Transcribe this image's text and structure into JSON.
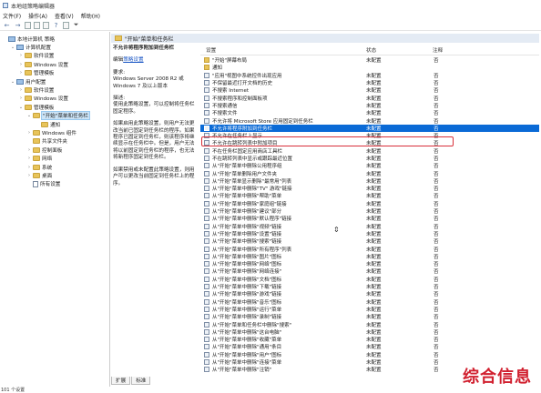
{
  "window": {
    "title": "本地组策略编辑器"
  },
  "menu": [
    "文件(F)",
    "操作(A)",
    "查看(V)",
    "帮助(H)"
  ],
  "toolbar_icons": [
    "back-arrow-icon",
    "forward-arrow-icon",
    "up-folder-icon",
    "show-tree-icon",
    "properties-icon",
    "help-icon",
    "filter-icon"
  ],
  "tree": [
    {
      "label": "本地计算机 策略",
      "level": 0,
      "type": "pc",
      "toggle": ""
    },
    {
      "label": "计算机配置",
      "level": 1,
      "type": "pc",
      "toggle": "v"
    },
    {
      "label": "软件设置",
      "level": 2,
      "type": "folder",
      "toggle": ">"
    },
    {
      "label": "Windows 设置",
      "level": 2,
      "type": "folder",
      "toggle": ">"
    },
    {
      "label": "管理模板",
      "level": 2,
      "type": "folder",
      "toggle": ">"
    },
    {
      "label": "用户配置",
      "level": 1,
      "type": "pc",
      "toggle": "v"
    },
    {
      "label": "软件设置",
      "level": 2,
      "type": "folder",
      "toggle": ">"
    },
    {
      "label": "Windows 设置",
      "level": 2,
      "type": "folder",
      "toggle": ">"
    },
    {
      "label": "管理模板",
      "level": 2,
      "type": "folder",
      "toggle": "v"
    },
    {
      "label": "\"开始\"菜单和任务栏",
      "level": 3,
      "type": "folder",
      "toggle": "v",
      "selected": true
    },
    {
      "label": "通知",
      "level": 4,
      "type": "folder",
      "toggle": ""
    },
    {
      "label": "Windows 组件",
      "level": 3,
      "type": "folder",
      "toggle": ">"
    },
    {
      "label": "共享文件夹",
      "level": 3,
      "type": "folder",
      "toggle": ""
    },
    {
      "label": "控制面板",
      "level": 3,
      "type": "folder",
      "toggle": ">"
    },
    {
      "label": "网络",
      "level": 3,
      "type": "folder",
      "toggle": ">"
    },
    {
      "label": "系统",
      "level": 3,
      "type": "folder",
      "toggle": ">"
    },
    {
      "label": "桌面",
      "level": 3,
      "type": "folder",
      "toggle": ">"
    },
    {
      "label": "所有设置",
      "level": 3,
      "type": "doc",
      "toggle": ""
    }
  ],
  "right_header": "\"开始\"菜单和任务栏",
  "description": {
    "title": "不允许将程序附加到任务栏",
    "edit_prefix": "编辑",
    "edit_link": "策略设置",
    "requirement_label": "要求:",
    "requirement_text": "Windows Server 2008 R2 或 Windows 7 及以上版本",
    "desc_label": "描述:",
    "desc_text": "使用此策略设置，可以控制将任务栏固定程序。",
    "para1": "如果启用此策略设置，则用户无法更改当前已固定到任务栏的程序。如果程序已固定到任务栏，则该程序将继续显示在任务栏中。但是，用户无法将以前固定到任务栏的程序，也无法将新程序固定到任务栏。",
    "para2": "如果禁用或未配置此策略设置，则用户可以更改当前固定到任务栏上的程序。"
  },
  "columns": {
    "setting": "设置",
    "state": "状态",
    "note": "注释"
  },
  "rows": [
    {
      "name": "\"开始\"屏幕布局",
      "state": "未配置",
      "note": "否",
      "folder": true
    },
    {
      "name": "通知",
      "state": "",
      "note": "",
      "folder": true
    },
    {
      "name": "\"应用\"视图中系统控件出现应用",
      "state": "未配置",
      "note": "否"
    },
    {
      "name": "不保留最近打开文档的历史",
      "state": "未配置",
      "note": "否"
    },
    {
      "name": "不搜索 Internet",
      "state": "未配置",
      "note": "否"
    },
    {
      "name": "不搜索程序和控制面板项",
      "state": "未配置",
      "note": "否"
    },
    {
      "name": "不搜索通信",
      "state": "未配置",
      "note": "否"
    },
    {
      "name": "不搜索文件",
      "state": "未配置",
      "note": "否"
    },
    {
      "name": "不允许将 Microsoft Store 应用固定到任务栏",
      "state": "未配置",
      "note": "否"
    },
    {
      "name": "不允许将程序附加到任务栏",
      "state": "未配置",
      "note": "否",
      "highlight": true
    },
    {
      "name": "不允许在任务栏上显示",
      "state": "未配置",
      "note": "否"
    },
    {
      "name": "不允许在跳转列表中附加项目",
      "state": "未配置",
      "note": "否"
    },
    {
      "name": "不在任务栏固定应用商店工具栏",
      "state": "未配置",
      "note": "否"
    },
    {
      "name": "不在跳转列表中显示或跟踪最近位置",
      "state": "未配置",
      "note": "否"
    },
    {
      "name": "从\"开始\"菜单中删除公用程序组",
      "state": "未配置",
      "note": "否"
    },
    {
      "name": "从\"开始\"菜单删除用户文件夹",
      "state": "未配置",
      "note": "否"
    },
    {
      "name": "从\"开始\"菜单显示删除\"最常用\"列表",
      "state": "未配置",
      "note": "否"
    },
    {
      "name": "从\"开始\"菜单中删除\"TV\" 游戏\"链接",
      "state": "未配置",
      "note": "否"
    },
    {
      "name": "从\"开始\"菜单中删除\"帮助\"菜单",
      "state": "未配置",
      "note": "否"
    },
    {
      "name": "从\"开始\"菜单中删除\"家庭组\"链接",
      "state": "未配置",
      "note": "否"
    },
    {
      "name": "从\"开始\"菜单中删除\"建议\"部分",
      "state": "未配置",
      "note": "否"
    },
    {
      "name": "从\"开始\"菜单中删除\"默认程序\"链接",
      "state": "未配置",
      "note": "否"
    },
    {
      "name": "从\"开始\"菜单中删除\"视频\"链接",
      "state": "未配置",
      "note": "否"
    },
    {
      "name": "从\"开始\"菜单中删除\"设置\"链接",
      "state": "未配置",
      "note": "否"
    },
    {
      "name": "从\"开始\"菜单中删除\"搜索\"链接",
      "state": "未配置",
      "note": "否"
    },
    {
      "name": "从\"开始\"菜单中删除\"所有程序\"列表",
      "state": "未配置",
      "note": "否"
    },
    {
      "name": "从\"开始\"菜单中删除\"图片\"图标",
      "state": "未配置",
      "note": "否"
    },
    {
      "name": "从\"开始\"菜单中删除\"网络\"图标",
      "state": "未配置",
      "note": "否"
    },
    {
      "name": "从\"开始\"菜单中删除\"网络连接\"",
      "state": "未配置",
      "note": "否"
    },
    {
      "name": "从\"开始\"菜单中删除\"文档\"图标",
      "state": "未配置",
      "note": "否"
    },
    {
      "name": "从\"开始\"菜单中删除\"下载\"链接",
      "state": "未配置",
      "note": "否"
    },
    {
      "name": "从\"开始\"菜单中删除\"游戏\"链接",
      "state": "未配置",
      "note": "否"
    },
    {
      "name": "从\"开始\"菜单中删除\"音乐\"图标",
      "state": "未配置",
      "note": "否"
    },
    {
      "name": "从\"开始\"菜单中删除\"运行\"菜单",
      "state": "未配置",
      "note": "否"
    },
    {
      "name": "从\"开始\"菜单中删除\"录制\"链接",
      "state": "未配置",
      "note": "否"
    },
    {
      "name": "从\"开始\"菜单和任务栏中删除\"搜索\"",
      "state": "未配置",
      "note": "否"
    },
    {
      "name": "从\"开始\"菜单中删除\"这台电脑\"",
      "state": "未配置",
      "note": "否"
    },
    {
      "name": "从\"开始\"菜单中删除\"收藏\"菜单",
      "state": "未配置",
      "note": "否"
    },
    {
      "name": "从\"开始\"菜单中删除\"通用\"条目",
      "state": "未配置",
      "note": "否"
    },
    {
      "name": "从\"开始\"菜单中删除\"用户\"图标",
      "state": "未配置",
      "note": "否"
    },
    {
      "name": "从\"开始\"菜单中删除\"连接\"菜单",
      "state": "未配置",
      "note": "否"
    },
    {
      "name": "从\"开始\"菜单中删除\"注销\"",
      "state": "未配置",
      "note": "否"
    }
  ],
  "bottom_tabs": [
    "扩展",
    "标准"
  ],
  "status": "101 个设置",
  "watermark": "综合信息"
}
